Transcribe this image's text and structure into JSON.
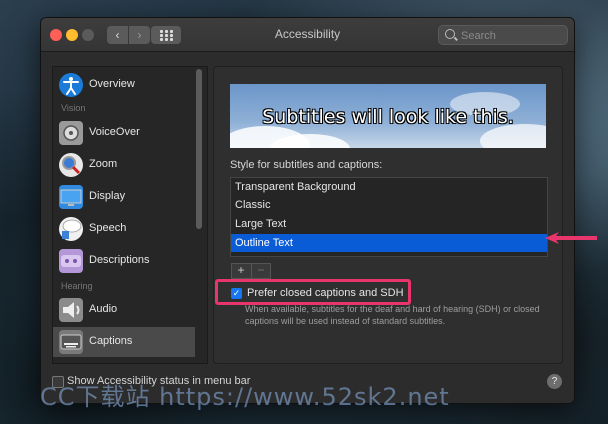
{
  "window": {
    "title": "Accessibility",
    "search_placeholder": "Search",
    "nav_back": "‹",
    "nav_forward": "›"
  },
  "sidebar": {
    "items": [
      {
        "label": "Overview",
        "icon": "accessibility-icon"
      },
      {
        "header": "Vision"
      },
      {
        "label": "VoiceOver",
        "icon": "voiceover-icon"
      },
      {
        "label": "Zoom",
        "icon": "zoom-icon"
      },
      {
        "label": "Display",
        "icon": "display-icon"
      },
      {
        "label": "Speech",
        "icon": "speech-icon"
      },
      {
        "label": "Descriptions",
        "icon": "descriptions-icon"
      },
      {
        "header": "Hearing"
      },
      {
        "label": "Audio",
        "icon": "audio-icon"
      },
      {
        "label": "Captions",
        "icon": "captions-icon",
        "selected": true
      }
    ]
  },
  "captions": {
    "preview_text": "Subtitles will look like this.",
    "style_label": "Style for subtitles and captions:",
    "styles": [
      {
        "label": "Transparent Background",
        "selected": false
      },
      {
        "label": "Classic",
        "selected": false
      },
      {
        "label": "Large Text",
        "selected": false
      },
      {
        "label": "Outline Text",
        "selected": true
      }
    ],
    "add_label": "+",
    "remove_label": "−",
    "sdh_checkbox": {
      "label": "Prefer closed captions and SDH",
      "checked": true
    },
    "sdh_description": "When available, subtitles for the deaf and hard of hearing (SDH) or closed captions will be used instead of standard subtitles."
  },
  "footer": {
    "menu_bar_checkbox": {
      "label": "Show Accessibility status in menu bar",
      "checked": false
    },
    "help_label": "?"
  },
  "watermark": "CC下载站 https://www.52sk2.net",
  "colors": {
    "highlight": "#e8356b",
    "selection": "#0a5bd6",
    "checkbox": "#1677f2"
  }
}
